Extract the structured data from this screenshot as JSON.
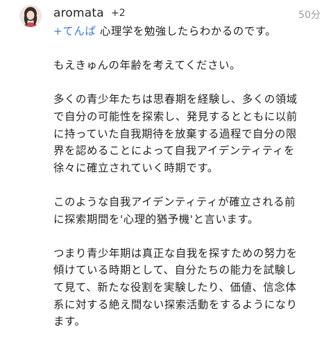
{
  "comment": {
    "author": "aromata",
    "plus_badge": "+2",
    "time": "50分",
    "mention": "+てんぱ",
    "first_line_rest": " 心理学を勉強したらわかるのです。",
    "paragraphs": [
      [
        "もえきゅんの年齢を考えてください。"
      ],
      [
        "多くの青少年たちは思春期を経験し、多くの領域",
        "で自分の可能性を探索し、発見するとともに以前",
        "に持っていた自我期待を放棄する過程で自分の限",
        "界を認めることによって自我アイデンティティを",
        "徐々に確立されていく時期です。"
      ],
      [
        "このような自我アイデンティティが確立される前",
        "に探索期間を'心理的猶予機'と言います。"
      ],
      [
        "つまり青少年期は真正な自我を探すための努力を",
        "傾けている時期として、自分たちの能力を試験し",
        "て見て、新たな役割を実験したり、価値、信念体",
        "系に対する絶え間ない探索活動をするようになり",
        "ます。"
      ]
    ]
  }
}
